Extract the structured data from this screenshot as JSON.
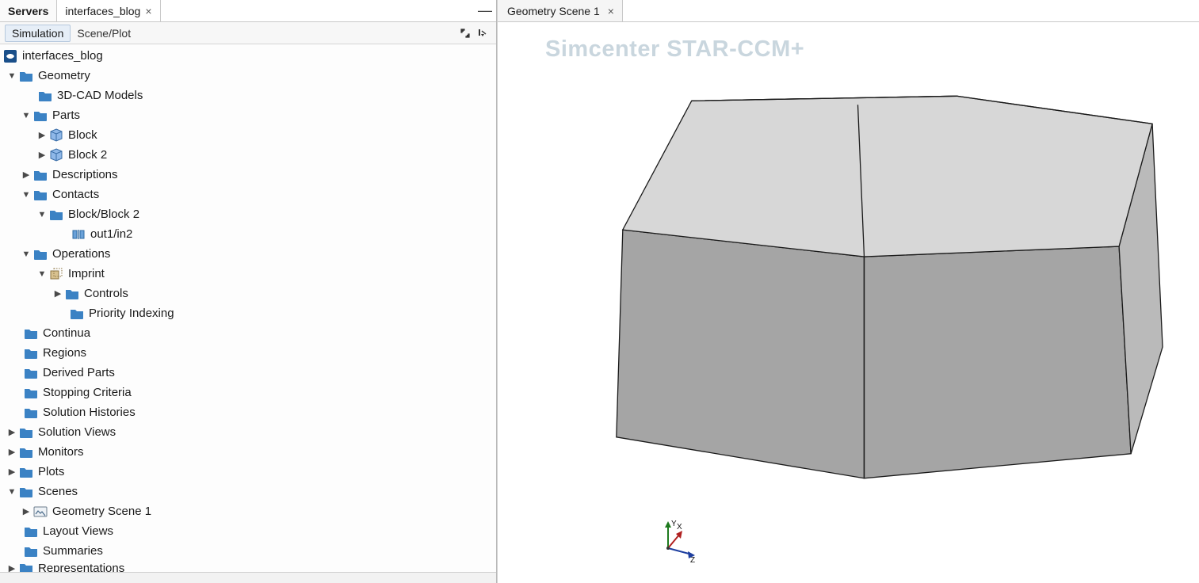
{
  "tabs": {
    "servers": "Servers",
    "file": "interfaces_blog"
  },
  "subheader": {
    "simulation": "Simulation",
    "sceneplot": "Scene/Plot"
  },
  "tree": {
    "root": "interfaces_blog",
    "geometry": "Geometry",
    "cad_models": "3D-CAD Models",
    "parts": "Parts",
    "block": "Block",
    "block2": "Block 2",
    "descriptions": "Descriptions",
    "contacts": "Contacts",
    "contact_pair": "Block/Block 2",
    "contact_leaf": "out1/in2",
    "operations": "Operations",
    "imprint": "Imprint",
    "controls": "Controls",
    "priority_indexing": "Priority Indexing",
    "continua": "Continua",
    "regions": "Regions",
    "derived_parts": "Derived Parts",
    "stopping_criteria": "Stopping Criteria",
    "solution_histories": "Solution Histories",
    "solution_views": "Solution Views",
    "monitors": "Monitors",
    "plots": "Plots",
    "scenes": "Scenes",
    "geometry_scene1": "Geometry Scene 1",
    "layout_views": "Layout Views",
    "summaries": "Summaries",
    "representations": "Representations"
  },
  "scene": {
    "tab": "Geometry Scene 1",
    "watermark": "Simcenter STAR-CCM+",
    "axis_x": "X",
    "axis_y": "Y",
    "axis_z": "Z"
  }
}
